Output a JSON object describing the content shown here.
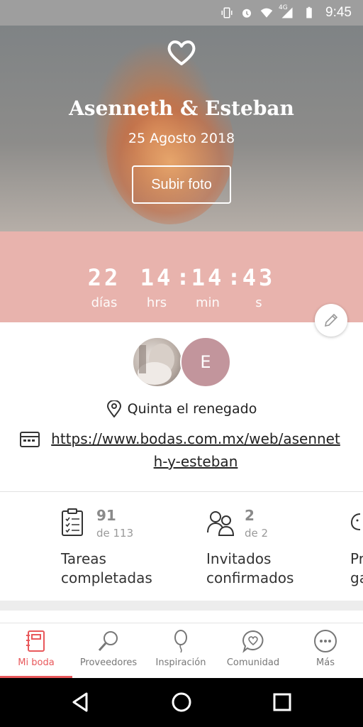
{
  "status_bar": {
    "time": "9:45",
    "network": "4G"
  },
  "hero": {
    "couple_name": "Asenneth & Esteban",
    "wedding_date": "25 Agosto 2018",
    "upload_button": "Subir foto"
  },
  "countdown": {
    "days": "22",
    "days_unit": "días",
    "hours": "14",
    "hours_unit": "hrs",
    "minutes": "14",
    "minutes_unit": "min",
    "seconds": "43",
    "seconds_unit": "s"
  },
  "profile": {
    "partner_initial": "E",
    "location": "Quinta el renegado",
    "website_url": "https://www.bodas.com.mx/web/asenneth-y-esteban"
  },
  "stats": [
    {
      "value": "91",
      "total": "de 113",
      "label": "Tareas completadas",
      "icon": "checklist-icon"
    },
    {
      "value": "2",
      "total": "de 2",
      "label": "Invitados confirmados",
      "icon": "guests-icon"
    },
    {
      "value": "",
      "total": "",
      "label": "Pr ga",
      "icon": "piggy-bank-icon"
    }
  ],
  "bottom_nav": [
    {
      "label": "Mi boda",
      "icon": "notebook-icon",
      "active": true
    },
    {
      "label": "Proveedores",
      "icon": "search-icon",
      "active": false
    },
    {
      "label": "Inspiración",
      "icon": "balloon-icon",
      "active": false
    },
    {
      "label": "Comunidad",
      "icon": "chat-heart-icon",
      "active": false
    },
    {
      "label": "Más",
      "icon": "more-icon",
      "active": false
    }
  ],
  "colors": {
    "accent": "#e8585b",
    "band": "#e8b3ad",
    "avatar": "#c2959c"
  }
}
